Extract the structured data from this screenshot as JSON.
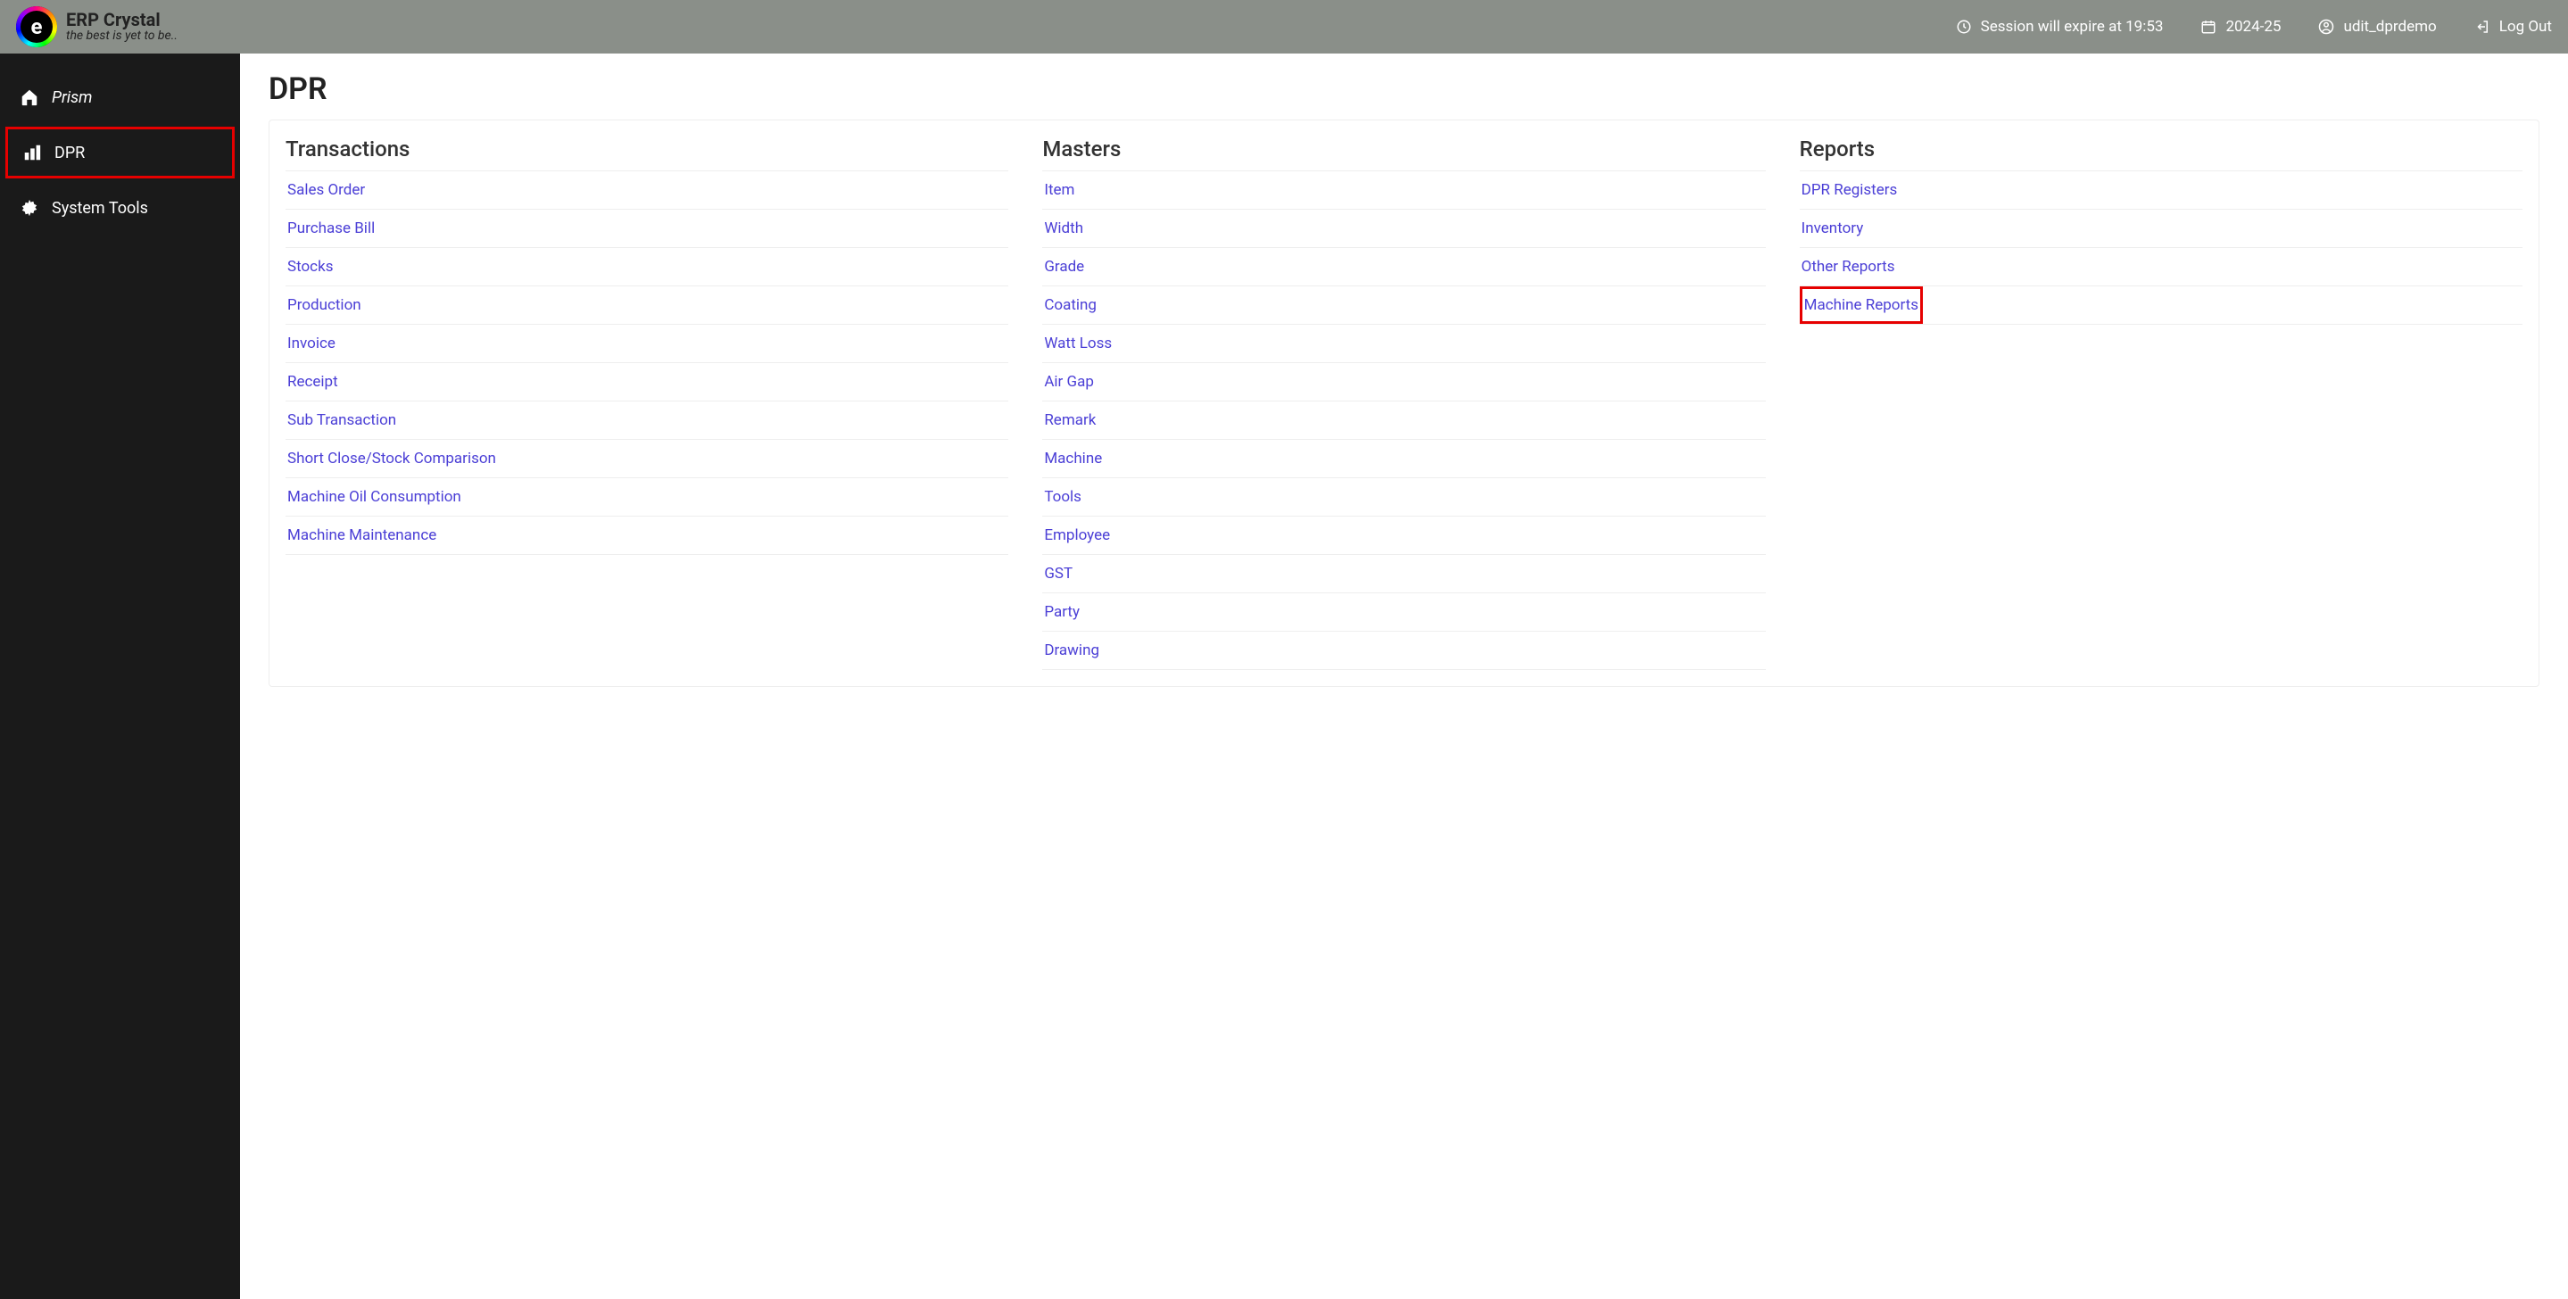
{
  "brand": {
    "logo_letter": "e",
    "title": "ERP Crystal",
    "tagline": "the best is yet to be.."
  },
  "header": {
    "session_label": "Session will expire at 19:53",
    "fy": "2024-25",
    "user": "udit_dprdemo",
    "logout": "Log Out"
  },
  "sidebar": {
    "items": [
      {
        "label": "Prism",
        "icon": "home"
      },
      {
        "label": "DPR",
        "icon": "bars",
        "active": true
      },
      {
        "label": "System Tools",
        "icon": "gear"
      }
    ]
  },
  "page": {
    "title": "DPR",
    "columns": [
      {
        "heading": "Transactions",
        "links": [
          "Sales Order",
          "Purchase Bill",
          "Stocks",
          "Production",
          "Invoice",
          "Receipt",
          "Sub Transaction",
          "Short Close/Stock Comparison",
          "Machine Oil Consumption",
          "Machine Maintenance"
        ]
      },
      {
        "heading": "Masters",
        "links": [
          "Item",
          "Width",
          "Grade",
          "Coating",
          "Watt Loss",
          "Air Gap",
          "Remark",
          "Machine",
          "Tools",
          "Employee",
          "GST",
          "Party",
          "Drawing"
        ]
      },
      {
        "heading": "Reports",
        "links": [
          "DPR Registers",
          "Inventory",
          "Other Reports",
          "Machine Reports"
        ],
        "highlight_index": 3
      }
    ]
  }
}
